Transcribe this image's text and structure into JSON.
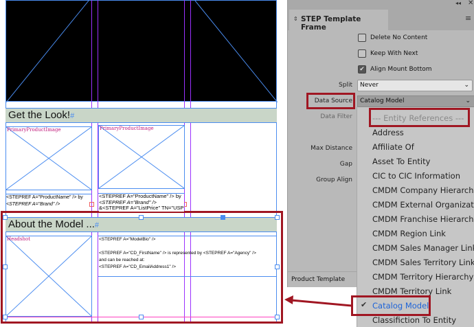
{
  "canvas": {
    "section1_title": "Get the Look!",
    "image_label_1": "PrimaryProductImage",
    "image_label_2": "PrimaryProductImage",
    "text1_line1": "<STEPREF A=\"ProductName\" /> by",
    "text1_line2": "<STEPREF A=\"Brand\" />",
    "text2_line1": "<STEPREF A=\"ProductName\" /> by",
    "text2_line2": "<STEPREF A=\"Brand\" />",
    "text2_line3": "&<STEPREF A=\"ListPrice\" TN=\"USPric",
    "section2_title": "About the Model ...",
    "headshot_label": "Headshot",
    "bio_line1": "<STEPREF A=\"ModelBio\" />",
    "bio_line2": "<STEPREF A=\"CD_FirstName\" /> is represented by <STEPREF A=\"Agency\" />",
    "bio_line3": "and can be reached at:",
    "bio_line4": "<STEPREF A=\"CD_EmailAddress1\" />"
  },
  "panel": {
    "title": "STEP Template Frame",
    "checkboxes": [
      {
        "label": "Delete No Content",
        "checked": false
      },
      {
        "label": "Keep With Next",
        "checked": false
      },
      {
        "label": "Align Mount Bottom",
        "checked": true
      }
    ],
    "split_label": "Split",
    "split_value": "Never",
    "data_source_label": "Data Source",
    "data_source_value": "Catalog Model",
    "data_filter_label": "Data Filter",
    "max_distance_label": "Max Distance",
    "gap_label": "Gap",
    "group_align_label": "Group Align",
    "footer": "Product Template"
  },
  "dropdown": {
    "header": "--- Entity References ---",
    "items": [
      "Address",
      "Affiliate Of",
      "Asset To Entity",
      "CIC to CIC Information",
      "CMDM Company Hierarchy",
      "CMDM External Organization",
      "CMDM Franchise Hierarchy",
      "CMDM Region Link",
      "CMDM Sales Manager Link",
      "CMDM Sales Territory Link",
      "CMDM Territory Hierarchy Link",
      "CMDM Territory Link",
      "Catalog Model",
      "Classifiction To Entity"
    ],
    "selected": "Catalog Model"
  },
  "colors": {
    "accent_red": "#a01622",
    "frame_blue": "#4a8cf0",
    "guide_purple": "#9b30ff",
    "selected_blue": "#1e64d8"
  }
}
